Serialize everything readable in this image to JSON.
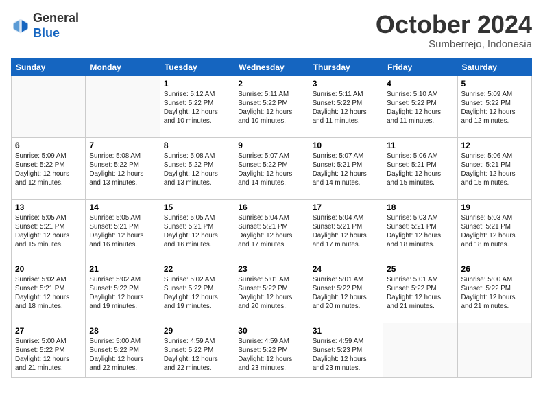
{
  "header": {
    "logo": {
      "general": "General",
      "blue": "Blue"
    },
    "title": "October 2024",
    "location": "Sumberrejo, Indonesia"
  },
  "calendar": {
    "days_of_week": [
      "Sunday",
      "Monday",
      "Tuesday",
      "Wednesday",
      "Thursday",
      "Friday",
      "Saturday"
    ],
    "weeks": [
      [
        {
          "day": "",
          "info": ""
        },
        {
          "day": "",
          "info": ""
        },
        {
          "day": "1",
          "info": "Sunrise: 5:12 AM\nSunset: 5:22 PM\nDaylight: 12 hours\nand 10 minutes."
        },
        {
          "day": "2",
          "info": "Sunrise: 5:11 AM\nSunset: 5:22 PM\nDaylight: 12 hours\nand 10 minutes."
        },
        {
          "day": "3",
          "info": "Sunrise: 5:11 AM\nSunset: 5:22 PM\nDaylight: 12 hours\nand 11 minutes."
        },
        {
          "day": "4",
          "info": "Sunrise: 5:10 AM\nSunset: 5:22 PM\nDaylight: 12 hours\nand 11 minutes."
        },
        {
          "day": "5",
          "info": "Sunrise: 5:09 AM\nSunset: 5:22 PM\nDaylight: 12 hours\nand 12 minutes."
        }
      ],
      [
        {
          "day": "6",
          "info": "Sunrise: 5:09 AM\nSunset: 5:22 PM\nDaylight: 12 hours\nand 12 minutes."
        },
        {
          "day": "7",
          "info": "Sunrise: 5:08 AM\nSunset: 5:22 PM\nDaylight: 12 hours\nand 13 minutes."
        },
        {
          "day": "8",
          "info": "Sunrise: 5:08 AM\nSunset: 5:22 PM\nDaylight: 12 hours\nand 13 minutes."
        },
        {
          "day": "9",
          "info": "Sunrise: 5:07 AM\nSunset: 5:22 PM\nDaylight: 12 hours\nand 14 minutes."
        },
        {
          "day": "10",
          "info": "Sunrise: 5:07 AM\nSunset: 5:21 PM\nDaylight: 12 hours\nand 14 minutes."
        },
        {
          "day": "11",
          "info": "Sunrise: 5:06 AM\nSunset: 5:21 PM\nDaylight: 12 hours\nand 15 minutes."
        },
        {
          "day": "12",
          "info": "Sunrise: 5:06 AM\nSunset: 5:21 PM\nDaylight: 12 hours\nand 15 minutes."
        }
      ],
      [
        {
          "day": "13",
          "info": "Sunrise: 5:05 AM\nSunset: 5:21 PM\nDaylight: 12 hours\nand 15 minutes."
        },
        {
          "day": "14",
          "info": "Sunrise: 5:05 AM\nSunset: 5:21 PM\nDaylight: 12 hours\nand 16 minutes."
        },
        {
          "day": "15",
          "info": "Sunrise: 5:05 AM\nSunset: 5:21 PM\nDaylight: 12 hours\nand 16 minutes."
        },
        {
          "day": "16",
          "info": "Sunrise: 5:04 AM\nSunset: 5:21 PM\nDaylight: 12 hours\nand 17 minutes."
        },
        {
          "day": "17",
          "info": "Sunrise: 5:04 AM\nSunset: 5:21 PM\nDaylight: 12 hours\nand 17 minutes."
        },
        {
          "day": "18",
          "info": "Sunrise: 5:03 AM\nSunset: 5:21 PM\nDaylight: 12 hours\nand 18 minutes."
        },
        {
          "day": "19",
          "info": "Sunrise: 5:03 AM\nSunset: 5:21 PM\nDaylight: 12 hours\nand 18 minutes."
        }
      ],
      [
        {
          "day": "20",
          "info": "Sunrise: 5:02 AM\nSunset: 5:21 PM\nDaylight: 12 hours\nand 18 minutes."
        },
        {
          "day": "21",
          "info": "Sunrise: 5:02 AM\nSunset: 5:22 PM\nDaylight: 12 hours\nand 19 minutes."
        },
        {
          "day": "22",
          "info": "Sunrise: 5:02 AM\nSunset: 5:22 PM\nDaylight: 12 hours\nand 19 minutes."
        },
        {
          "day": "23",
          "info": "Sunrise: 5:01 AM\nSunset: 5:22 PM\nDaylight: 12 hours\nand 20 minutes."
        },
        {
          "day": "24",
          "info": "Sunrise: 5:01 AM\nSunset: 5:22 PM\nDaylight: 12 hours\nand 20 minutes."
        },
        {
          "day": "25",
          "info": "Sunrise: 5:01 AM\nSunset: 5:22 PM\nDaylight: 12 hours\nand 21 minutes."
        },
        {
          "day": "26",
          "info": "Sunrise: 5:00 AM\nSunset: 5:22 PM\nDaylight: 12 hours\nand 21 minutes."
        }
      ],
      [
        {
          "day": "27",
          "info": "Sunrise: 5:00 AM\nSunset: 5:22 PM\nDaylight: 12 hours\nand 21 minutes."
        },
        {
          "day": "28",
          "info": "Sunrise: 5:00 AM\nSunset: 5:22 PM\nDaylight: 12 hours\nand 22 minutes."
        },
        {
          "day": "29",
          "info": "Sunrise: 4:59 AM\nSunset: 5:22 PM\nDaylight: 12 hours\nand 22 minutes."
        },
        {
          "day": "30",
          "info": "Sunrise: 4:59 AM\nSunset: 5:22 PM\nDaylight: 12 hours\nand 23 minutes."
        },
        {
          "day": "31",
          "info": "Sunrise: 4:59 AM\nSunset: 5:23 PM\nDaylight: 12 hours\nand 23 minutes."
        },
        {
          "day": "",
          "info": ""
        },
        {
          "day": "",
          "info": ""
        }
      ]
    ]
  }
}
